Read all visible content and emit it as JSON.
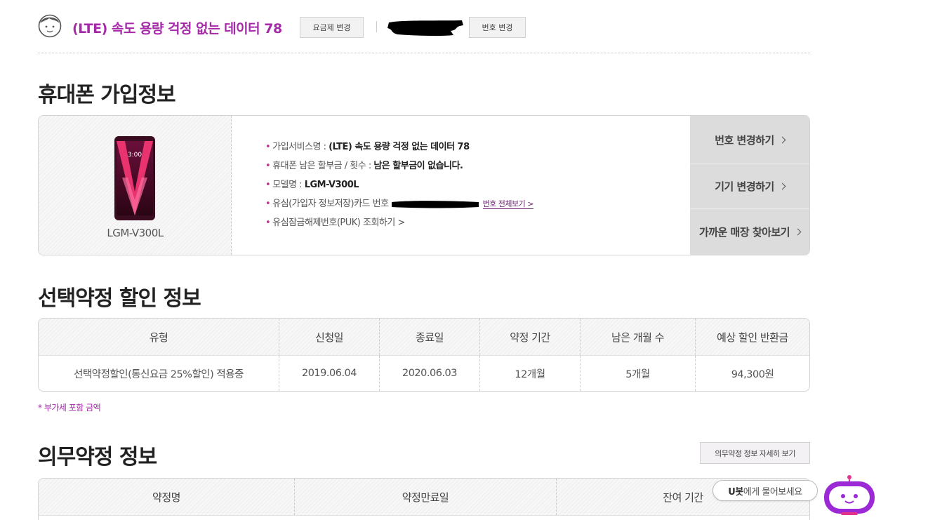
{
  "plan_bar": {
    "plan_name": "(LTE) 속도 용량 걱정 없는 데이터 78",
    "change_plan_button": "요금제 변경",
    "change_number_button": "번호 변경"
  },
  "phone_section": {
    "title": "휴대폰 가입정보",
    "model_label": "LGM-V300L",
    "phone_screen_time": "3:00",
    "info": [
      {
        "label": "가입서비스명 : ",
        "value": "(LTE) 속도 용량 걱정 없는 데이터 78"
      },
      {
        "label": "휴대폰 남은 할부금 / 횟수 : ",
        "value": "남은 할부금이 없습니다."
      },
      {
        "label": "모델명 : ",
        "value": "LGM-V300L"
      },
      {
        "label": "유심(가입자 정보저장)카드 번호",
        "link": "번호 전체보기"
      },
      {
        "label": "유심잠금해제번호(PUK) 조회하기 >"
      }
    ],
    "side_buttons": [
      "번호 변경하기",
      "기기 변경하기",
      "가까운 매장 찾아보기"
    ]
  },
  "select_contract": {
    "title": "선택약정 할인 정보",
    "columns": [
      "유형",
      "신청일",
      "종료일",
      "약정 기간",
      "남은 개월 수",
      "예상 할인 반환금"
    ],
    "rows": [
      [
        "선택약정할인(통신요금 25%할인) 적용중",
        "2019.06.04",
        "2020.06.03",
        "12개월",
        "5개월",
        "94,300원"
      ]
    ],
    "note": "* 부가세 포함 금액"
  },
  "mandatory_contract": {
    "title": "의무약정 정보",
    "detail_button": "의무약정 정보 자세히 보기",
    "columns": [
      "약정명",
      "약정만료일",
      "잔여 기간"
    ]
  },
  "ubot": {
    "bubble_bold": "U봇",
    "bubble_text": "에게 물어보세요"
  },
  "colors": {
    "accent_purple": "#a52aa8",
    "bullet": "#b5388a",
    "side_button_bg": "#dcdcdc"
  }
}
